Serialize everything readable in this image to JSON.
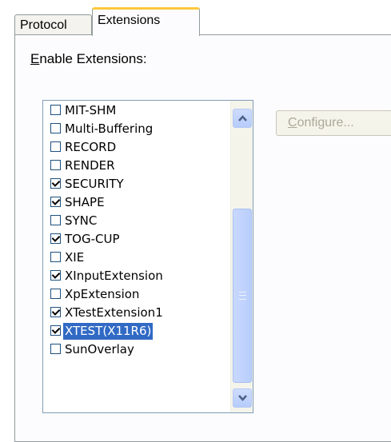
{
  "tabs": [
    {
      "label": "Protocol",
      "active": false
    },
    {
      "label": "Extensions",
      "active": true
    }
  ],
  "enable_label": {
    "mnemonic": "E",
    "rest": "nable Extensions:"
  },
  "configure_button": {
    "mnemonic": "C",
    "rest": "onfigure...",
    "enabled": false
  },
  "extensions": [
    {
      "label": "MIT-SHM",
      "checked": false
    },
    {
      "label": "Multi-Buffering",
      "checked": false
    },
    {
      "label": "RECORD",
      "checked": false
    },
    {
      "label": "RENDER",
      "checked": false
    },
    {
      "label": "SECURITY",
      "checked": true
    },
    {
      "label": "SHAPE",
      "checked": true
    },
    {
      "label": "SYNC",
      "checked": false
    },
    {
      "label": "TOG-CUP",
      "checked": true
    },
    {
      "label": "XIE",
      "checked": false
    },
    {
      "label": "XInputExtension",
      "checked": true
    },
    {
      "label": "XpExtension",
      "checked": false
    },
    {
      "label": "XTestExtension1",
      "checked": true
    },
    {
      "label": "XTEST(X11R6)",
      "checked": true,
      "selected": true
    },
    {
      "label": "SunOverlay",
      "checked": false
    }
  ],
  "icons": {
    "scroll_up": "chevron-up-icon",
    "scroll_down": "chevron-down-icon"
  },
  "colors": {
    "selection": "#316ac5",
    "active_tab_highlight": "#ffc83c"
  }
}
